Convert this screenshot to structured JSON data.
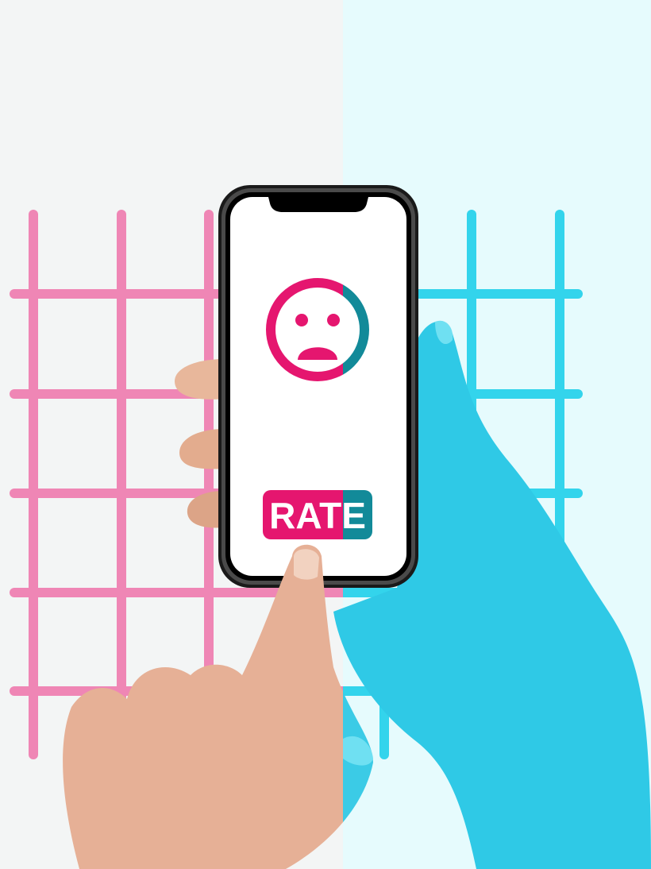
{
  "colors": {
    "pink": "#e5166f",
    "teal": "#128a99",
    "grid_pink": "#ef86b5",
    "grid_cyan": "#33d4ec",
    "bg_left": "#f3f5f5",
    "bg_right": "#e6fbfd",
    "hand_cyan": "#2fc9e6"
  },
  "screen": {
    "icon": "sad-face-icon",
    "button_label": "RATE"
  }
}
